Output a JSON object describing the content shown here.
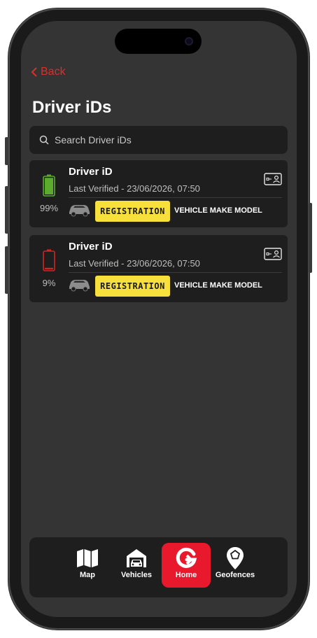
{
  "nav": {
    "back_label": "Back"
  },
  "page": {
    "title": "Driver iDs"
  },
  "search": {
    "placeholder": "Search Driver iDs"
  },
  "drivers": [
    {
      "name": "Driver iD",
      "last_verified": "Last Verified - 23/06/2026, 07:50",
      "battery_pct": "99%",
      "battery_level": 0.99,
      "battery_color": "#5dab2e",
      "registration": "REGISTRATION",
      "vehicle": "VEHICLE MAKE MODEL"
    },
    {
      "name": "Driver iD",
      "last_verified": "Last Verified - 23/06/2026, 07:50",
      "battery_pct": "9%",
      "battery_level": 0.09,
      "battery_color": "#d32424",
      "registration": "REGISTRATION",
      "vehicle": "VEHICLE MAKE MODEL"
    }
  ],
  "tabs": [
    {
      "label": "Map",
      "icon": "map-icon",
      "active": false
    },
    {
      "label": "Vehicles",
      "icon": "garage-car-icon",
      "active": false
    },
    {
      "label": "Home",
      "icon": "home-g-logo-icon",
      "active": true
    },
    {
      "label": "Geofences",
      "icon": "geofence-pin-icon",
      "active": false
    }
  ],
  "colors": {
    "accent": "#e8192c",
    "back": "#d9302c",
    "plate": "#f7df3c",
    "background": "#343434",
    "card": "#1e1e1e"
  }
}
